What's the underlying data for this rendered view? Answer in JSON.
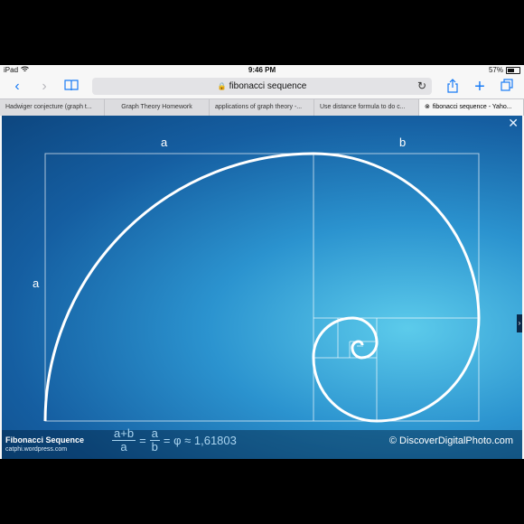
{
  "status_bar": {
    "device": "iPad",
    "time": "9:46 PM",
    "battery_percent": "57%",
    "battery_level": 0.57
  },
  "toolbar": {
    "url_text": "fibonacci sequence"
  },
  "tabs": [
    {
      "label": "Hadwiger conjecture (graph t...",
      "active": false
    },
    {
      "label": "Graph Theory Homework",
      "active": false
    },
    {
      "label": "applications of graph theory -...",
      "active": false
    },
    {
      "label": "Use distance formula to do c...",
      "active": false
    },
    {
      "label": "fibonacci sequence - Yaho...",
      "active": true
    }
  ],
  "image": {
    "label_a_top": "a",
    "label_b_top": "b",
    "label_a_side": "a",
    "caption_title": "Fibonacci Sequence",
    "caption_source": "catphi.wordpress.com",
    "copyright": "© DiscoverDigitalPhoto.com",
    "formula": {
      "num1": "a+b",
      "den1": "a",
      "eq1": "=",
      "num2": "a",
      "den2": "b",
      "tail": "= φ ≈ 1,61803"
    }
  }
}
